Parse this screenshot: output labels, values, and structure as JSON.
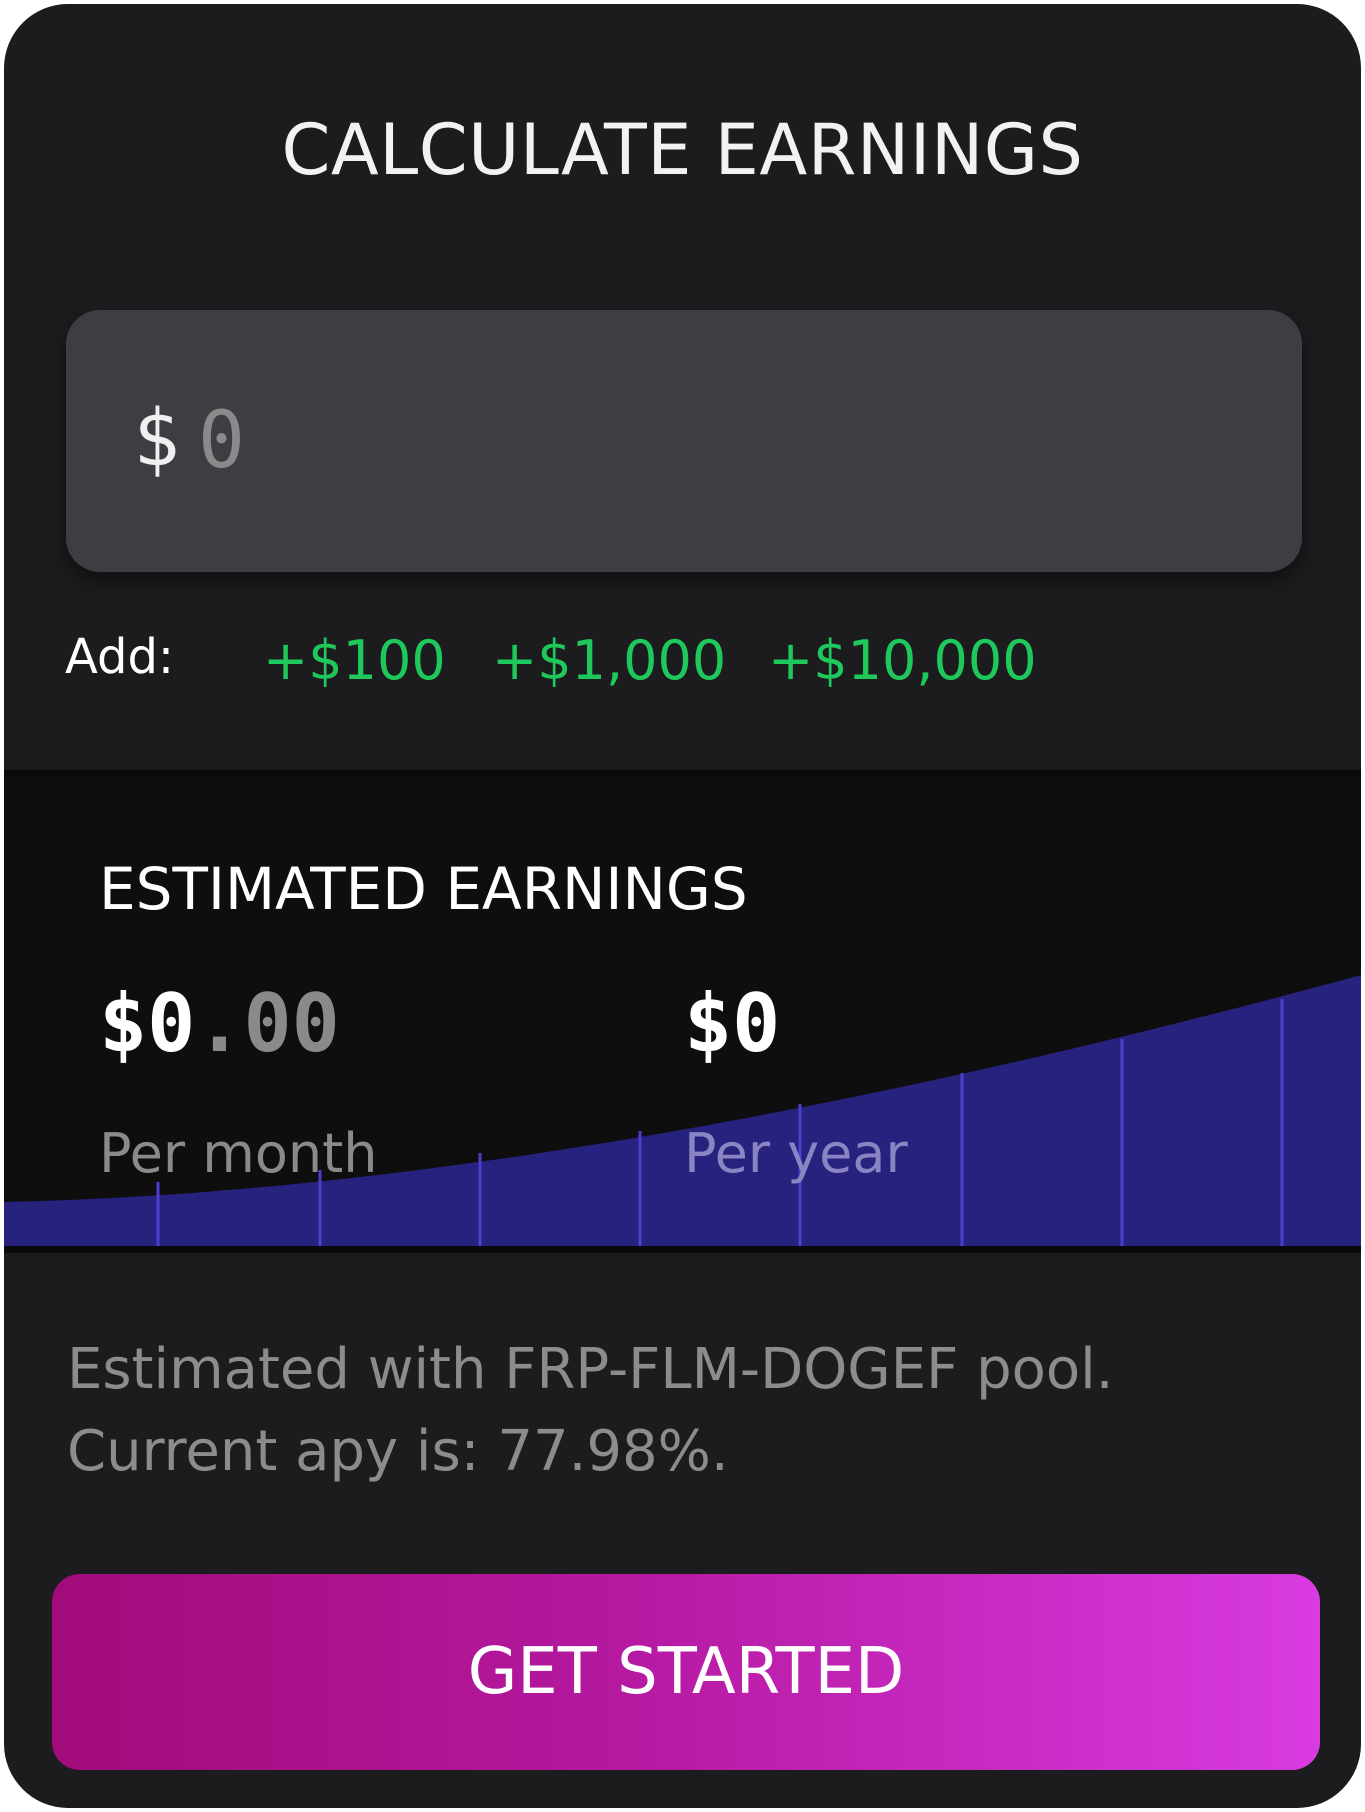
{
  "calculator": {
    "title": "CALCULATE EARNINGS",
    "currency_symbol": "$",
    "amount_placeholder": "0",
    "add_label": "Add:",
    "quick_adds": [
      "+$100",
      "+$1,000",
      "+$10,000"
    ]
  },
  "estimate": {
    "title": "ESTIMATED EARNINGS",
    "monthly_int": "$0",
    "monthly_frac": ".00",
    "monthly_label": "Per month",
    "yearly_value": "$0",
    "yearly_label": "Per year"
  },
  "info": {
    "line1": "Estimated with FRP-FLM-DOGEF pool.",
    "line2": "Current apy is: 77.98%."
  },
  "cta": {
    "label": "GET STARTED"
  },
  "colors": {
    "card": "#1c1c1e",
    "input": "#3d3e43",
    "accent_green": "#1fc85a",
    "chart_fill": "#28227f",
    "cta_start": "#a10b7a",
    "cta_end": "#d83be0"
  }
}
